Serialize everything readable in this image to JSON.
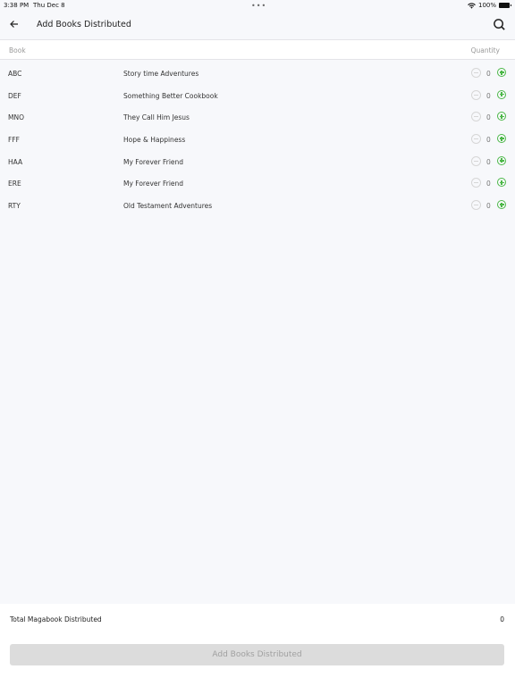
{
  "status_bar": {
    "time": "3:38 PM",
    "date": "Thu Dec 8",
    "dots": "•••",
    "battery_percent": "100%"
  },
  "header": {
    "back_icon": "arrow-left-icon",
    "title": "Add Books Distributed",
    "search_icon": "search-icon"
  },
  "table": {
    "columns": {
      "book": "Book",
      "quantity": "Quantity"
    },
    "rows": [
      {
        "code": "ABC",
        "name": "Story time Adventures",
        "quantity": "0"
      },
      {
        "code": "DEF",
        "name": "Something Better Cookbook",
        "quantity": "0"
      },
      {
        "code": "MNO",
        "name": "They Call Him Jesus",
        "quantity": "0"
      },
      {
        "code": "FFF",
        "name": "Hope & Happiness",
        "quantity": "0"
      },
      {
        "code": "HAA",
        "name": "My Forever Friend",
        "quantity": "0"
      },
      {
        "code": "ERE",
        "name": "My Forever Friend",
        "quantity": "0"
      },
      {
        "code": "RTY",
        "name": "Old Testament Adventures",
        "quantity": "0"
      }
    ]
  },
  "footer": {
    "total_label": "Total Magabook Distributed",
    "total_value": "0",
    "submit_label": "Add Books Distributed"
  },
  "colors": {
    "accent_green": "#4cb848",
    "disabled_button": "#dcdcdc"
  }
}
